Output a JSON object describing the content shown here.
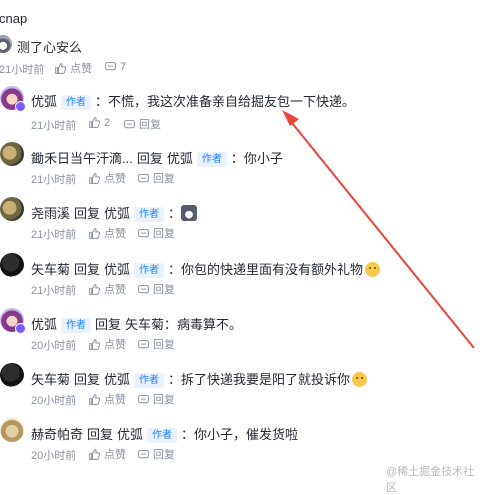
{
  "top": {
    "username_partial": "cnap",
    "content": "测了心安么",
    "time": "21小时前",
    "like_label": "点赞",
    "comment_count": "7"
  },
  "replies": [
    {
      "username": "优弧",
      "badge": "作者",
      "content": "：不慌，我这次准备亲自给掘友包一下快递。",
      "time": "21小时前",
      "likes": "2",
      "reply_label": "回复"
    },
    {
      "username": "鋤禾日当午汗滴...",
      "reply_word": "回复",
      "target": "优弧",
      "badge": "作者",
      "content": "：你小子",
      "time": "21小时前",
      "like_label": "点赞",
      "reply_label": "回复"
    },
    {
      "username": "尧雨溪",
      "reply_word": "回复",
      "target": "优弧",
      "badge": "作者",
      "content": "：",
      "sticker": "cat-sticker",
      "time": "21小时前",
      "like_label": "点赞",
      "reply_label": "回复"
    },
    {
      "username": "矢车菊",
      "reply_word": "回复",
      "target": "优弧",
      "badge": "作者",
      "content": "：你包的快递里面有没有额外礼物",
      "emoji": "smile-emoji",
      "time": "21小时前",
      "like_label": "点赞",
      "reply_label": "回复"
    },
    {
      "username": "优弧",
      "badge": "作者",
      "reply_word": "回复",
      "target": "矢车菊",
      "content": "：病毒算不。",
      "time": "20小时前",
      "like_label": "点赞",
      "reply_label": "回复"
    },
    {
      "username": "矢车菊",
      "reply_word": "回复",
      "target": "优弧",
      "badge": "作者",
      "content": "：拆了快递我要是阳了就投诉你",
      "emoji": "wink-emoji",
      "time": "20小时前",
      "like_label": "点赞",
      "reply_label": "回复"
    },
    {
      "username": "赫奇帕奇",
      "reply_word": "回复",
      "target": "优弧",
      "badge": "作者",
      "content": "：你小子，催发货啦",
      "time": "20小时前",
      "like_label": "点赞",
      "reply_label": "回复"
    }
  ],
  "watermark": "@稀土掘金技术社区",
  "colors": {
    "badge_bg": "#eaf2ff",
    "badge_text": "#1e80ff",
    "meta": "#8a919f",
    "arrow": "#e8453c"
  }
}
